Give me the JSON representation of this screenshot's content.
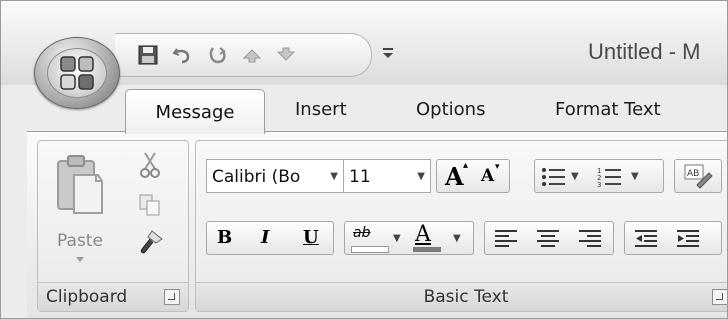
{
  "window": {
    "title": "Untitled - M"
  },
  "quick_access": {
    "items": [
      {
        "name": "save-icon"
      },
      {
        "name": "undo-icon"
      },
      {
        "name": "redo-icon"
      },
      {
        "name": "previous-item-icon"
      },
      {
        "name": "next-item-icon"
      }
    ],
    "customize_glyph": "⩮"
  },
  "tabs": [
    {
      "label": "Message",
      "selected": true
    },
    {
      "label": "Insert"
    },
    {
      "label": "Options"
    },
    {
      "label": "Format Text"
    }
  ],
  "clipboard": {
    "paste_label": "Paste",
    "group_label": "Clipboard"
  },
  "basic_text": {
    "font_name": "Calibri (Bo",
    "font_size": "11",
    "bold_label": "B",
    "italic_label": "I",
    "underline_label": "U",
    "grow_font_label": "A",
    "shrink_font_label": "A",
    "font_color_label": "A",
    "highlight_label": "ab",
    "spelling_label": "AB",
    "group_label": "Basic Text"
  },
  "colors": {
    "highlight_bar": "#ffffff",
    "font_color_bar": "#7a7a7a"
  }
}
